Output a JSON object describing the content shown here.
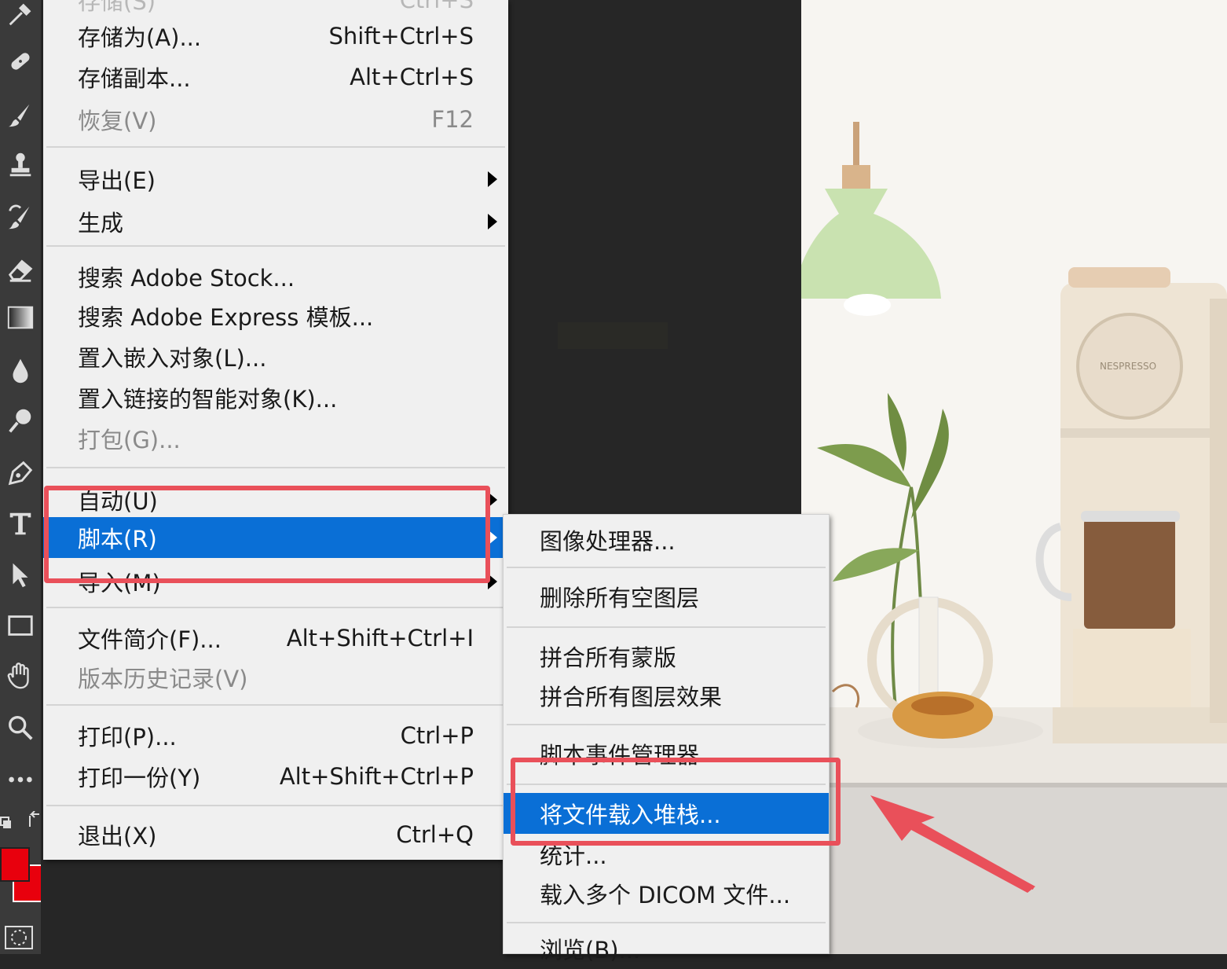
{
  "file_menu": {
    "items": [
      {
        "label": "存储为(A)...",
        "shortcut": "Shift+Ctrl+S",
        "disabled": false,
        "submenu": false
      },
      {
        "label": "存储副本...",
        "shortcut": "Alt+Ctrl+S",
        "disabled": false,
        "submenu": false
      },
      {
        "label": "恢复(V)",
        "shortcut": "F12",
        "disabled": true,
        "submenu": false
      },
      {
        "label": "导出(E)",
        "shortcut": "",
        "disabled": false,
        "submenu": true
      },
      {
        "label": "生成",
        "shortcut": "",
        "disabled": false,
        "submenu": true
      },
      {
        "label": "搜索 Adobe Stock...",
        "shortcut": "",
        "disabled": false,
        "submenu": false
      },
      {
        "label": "搜索 Adobe Express 模板...",
        "shortcut": "",
        "disabled": false,
        "submenu": false
      },
      {
        "label": "置入嵌入对象(L)...",
        "shortcut": "",
        "disabled": false,
        "submenu": false
      },
      {
        "label": "置入链接的智能对象(K)...",
        "shortcut": "",
        "disabled": false,
        "submenu": false
      },
      {
        "label": "打包(G)...",
        "shortcut": "",
        "disabled": true,
        "submenu": false
      },
      {
        "label": "自动(U)",
        "shortcut": "",
        "disabled": false,
        "submenu": true
      },
      {
        "label": "脚本(R)",
        "shortcut": "",
        "disabled": false,
        "submenu": true,
        "highlighted": true
      },
      {
        "label": "导入(M)",
        "shortcut": "",
        "disabled": false,
        "submenu": true
      },
      {
        "label": "文件简介(F)...",
        "shortcut": "Alt+Shift+Ctrl+I",
        "disabled": false,
        "submenu": false
      },
      {
        "label": "版本历史记录(V)",
        "shortcut": "",
        "disabled": true,
        "submenu": false
      },
      {
        "label": "打印(P)...",
        "shortcut": "Ctrl+P",
        "disabled": false,
        "submenu": false
      },
      {
        "label": "打印一份(Y)",
        "shortcut": "Alt+Shift+Ctrl+P",
        "disabled": false,
        "submenu": false
      },
      {
        "label": "退出(X)",
        "shortcut": "Ctrl+Q",
        "disabled": false,
        "submenu": false
      }
    ]
  },
  "script_submenu": {
    "items": [
      {
        "label": "图像处理器..."
      },
      {
        "label": "删除所有空图层"
      },
      {
        "label": "拼合所有蒙版"
      },
      {
        "label": "拼合所有图层效果"
      },
      {
        "label": "脚本事件管理器"
      },
      {
        "label": "将文件载入堆栈...",
        "highlighted": true
      },
      {
        "label": "统计..."
      },
      {
        "label": "载入多个 DICOM 文件..."
      },
      {
        "label": "浏览(B)..."
      }
    ]
  },
  "toolbar": {
    "tools": [
      "eyedropper-icon",
      "healing-brush-icon",
      "brush-icon",
      "clone-stamp-icon",
      "history-brush-icon",
      "eraser-icon",
      "gradient-icon",
      "blur-icon",
      "dodge-icon",
      "pen-icon",
      "type-icon",
      "path-selection-icon",
      "rectangle-icon",
      "hand-icon",
      "zoom-icon",
      "more-tools-icon"
    ],
    "foreground_color": "#e8000d",
    "background_color": "#e8000d"
  },
  "colors": {
    "menu_bg": "#f0f0f0",
    "highlight": "#0a6fd6",
    "annotation": "#e9505a"
  }
}
